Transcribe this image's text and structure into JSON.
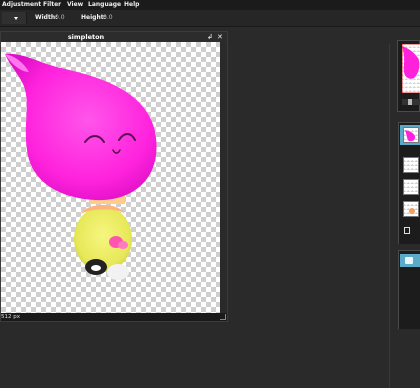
{
  "menu": {
    "items": [
      "Adjustment",
      "Filter",
      "View",
      "Language",
      "Help"
    ]
  },
  "options": {
    "width_label": "Width:",
    "width_value": "0.0",
    "height_label": "Height:",
    "height_value": "0.0"
  },
  "document": {
    "title": "simpleton",
    "zoom_status": "512 px"
  },
  "panels": {
    "layers_count": 4,
    "history_count": 1
  },
  "colors": {
    "accent": "#5aaac8",
    "character_head": "#ff22dd",
    "character_body": "#ecec5e"
  }
}
